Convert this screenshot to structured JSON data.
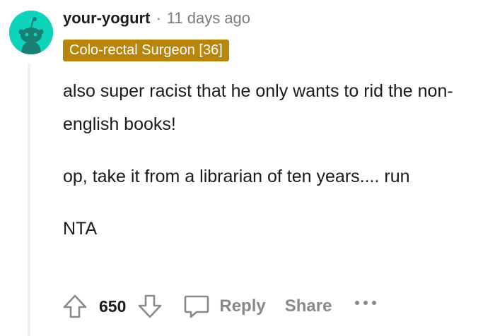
{
  "comment": {
    "username": "your-yogurt",
    "separator": "·",
    "timestamp": "11 days ago",
    "flair": "Colo-rectal Surgeon [36]",
    "paragraphs": [
      "also super racist that he only wants to rid the non-english books!",
      "op, take it from a librarian of ten years.... run",
      "NTA"
    ]
  },
  "actions": {
    "score": "650",
    "reply_label": "Reply",
    "share_label": "Share"
  },
  "colors": {
    "avatar_bg": "#0dd3bb",
    "flair_bg": "#b8860b",
    "muted_text": "#878a8c"
  },
  "icons": {
    "avatar": "snoo-avatar-icon",
    "upvote": "upvote-arrow-icon",
    "downvote": "downvote-arrow-icon",
    "reply": "speech-bubble-icon",
    "more": "more-options-icon"
  }
}
